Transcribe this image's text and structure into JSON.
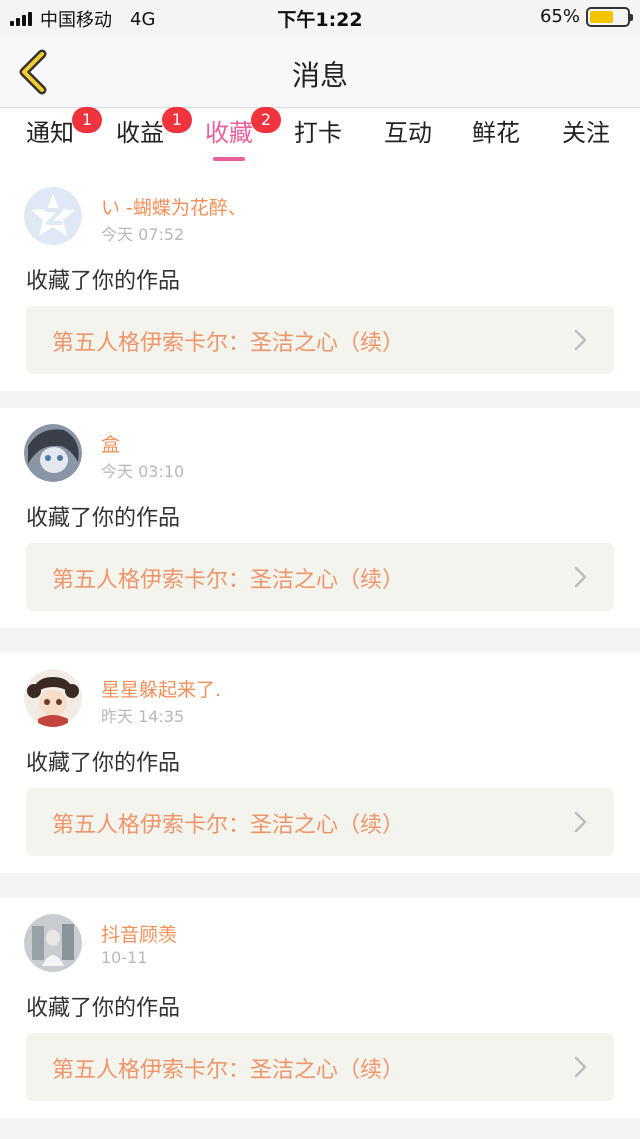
{
  "status_bar": {
    "carrier": "中国移动",
    "network": "4G",
    "time": "下午1:22",
    "battery": "65%",
    "battery_level": 0.65
  },
  "header": {
    "title": "消息",
    "back_icon": "chevron-left-icon"
  },
  "tabs": [
    {
      "label": "通知",
      "badge": "1"
    },
    {
      "label": "收益",
      "badge": "1"
    },
    {
      "label": "收藏",
      "badge": "2",
      "active": true
    },
    {
      "label": "打卡"
    },
    {
      "label": "互动"
    },
    {
      "label": "鲜花"
    },
    {
      "label": "关注"
    }
  ],
  "colors": {
    "accent": "#e8609a",
    "badge": "#f0333d",
    "username": "#f2905a",
    "work_title": "#f0956a"
  },
  "items": [
    {
      "username": "い -蝴蝶为花醉、",
      "time": "今天 07:52",
      "action": "收藏了你的作品",
      "work_title": "第五人格伊索卡尔：圣洁之心（续）"
    },
    {
      "username": "盒",
      "time": "今天 03:10",
      "action": "收藏了你的作品",
      "work_title": "第五人格伊索卡尔：圣洁之心（续）"
    },
    {
      "username": "星星躲起来了.",
      "time": "昨天 14:35",
      "action": "收藏了你的作品",
      "work_title": "第五人格伊索卡尔：圣洁之心（续）"
    },
    {
      "username": "抖音顾羡",
      "time": "10-11",
      "action": "收藏了你的作品",
      "work_title": "第五人格伊索卡尔：圣洁之心（续）"
    }
  ]
}
